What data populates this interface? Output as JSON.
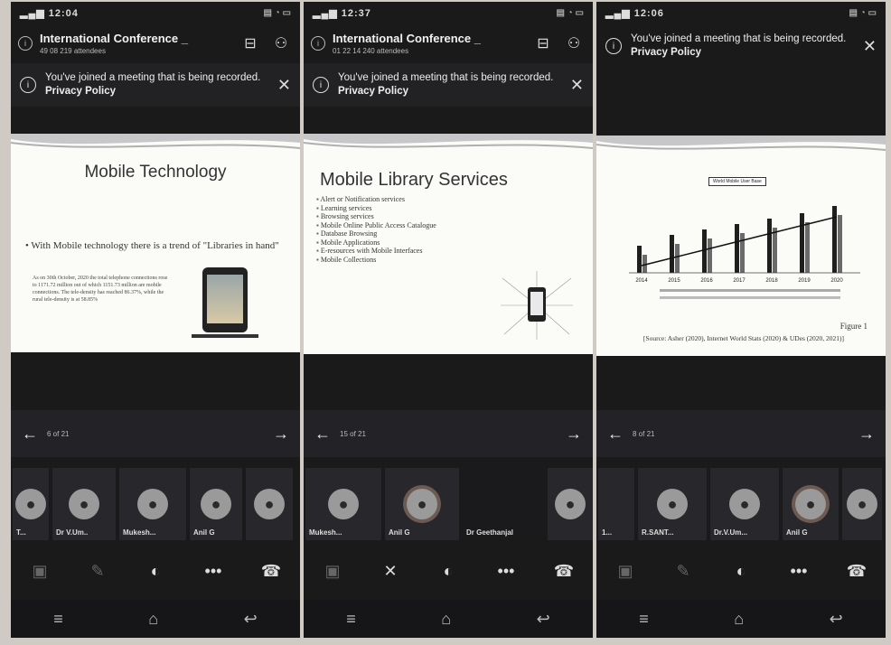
{
  "panels": [
    {
      "time": "12:04",
      "meeting_title": "International Conference _",
      "meeting_sub": "49 08  219 attendees",
      "banner_text": "You've joined a meeting that is being recorded.",
      "banner_link": "Privacy Policy",
      "slide_title": "Mobile Technology",
      "slide_body_1": "With Mobile technology there is a trend of \"Libraries in hand\"",
      "slide_body_2": "As on 30th October, 2020 the total telephone connections rose to 1171.72 million out of which 1151.73 million are mobile connections. The tele-density has reached 86.37%, while the rural tele-density is at 58.85%",
      "page_label": "6 of 21",
      "participants": [
        "T...",
        "Dr V.Um..",
        "Mukesh...",
        "Anil G",
        ""
      ]
    },
    {
      "time": "12:37",
      "meeting_title": "International Conference _",
      "meeting_sub": "01 22 14  240 attendees",
      "banner_text": "You've joined a meeting that is being recorded.",
      "banner_link": "Privacy Policy",
      "slide_title": "Mobile Library Services",
      "bullets": [
        "Alert or Notification services",
        "Learning services",
        "Browsing services",
        "Mobile Online Public Access Catalogue",
        "Database Browsing",
        "Mobile Applications",
        "E-resources with Mobile Interfaces",
        "Mobile Collections"
      ],
      "page_label": "15 of 21",
      "participants": [
        "Mukesh...",
        "Anil G",
        "Dr Geethanjal",
        ""
      ]
    },
    {
      "time": "12:06",
      "banner_text": "You've joined a meeting that is being recorded.",
      "banner_link": "Privacy Policy",
      "chart_title": "World Mobile User Base",
      "chart_years": [
        "2014",
        "2015",
        "2016",
        "2017",
        "2018",
        "2019",
        "2020"
      ],
      "figure_label": "Figure 1",
      "figure_source": "[Source: Asher (2020), Internet World Stats (2020) & UDes (2020, 2021)]",
      "page_label": "8 of 21",
      "participants": [
        "1...",
        "R.SANT...",
        "Dr.V.Um...",
        "Anil G",
        ""
      ]
    }
  ],
  "icons": {
    "back": "←",
    "forward": "→",
    "more": "•••",
    "close": "✕"
  }
}
